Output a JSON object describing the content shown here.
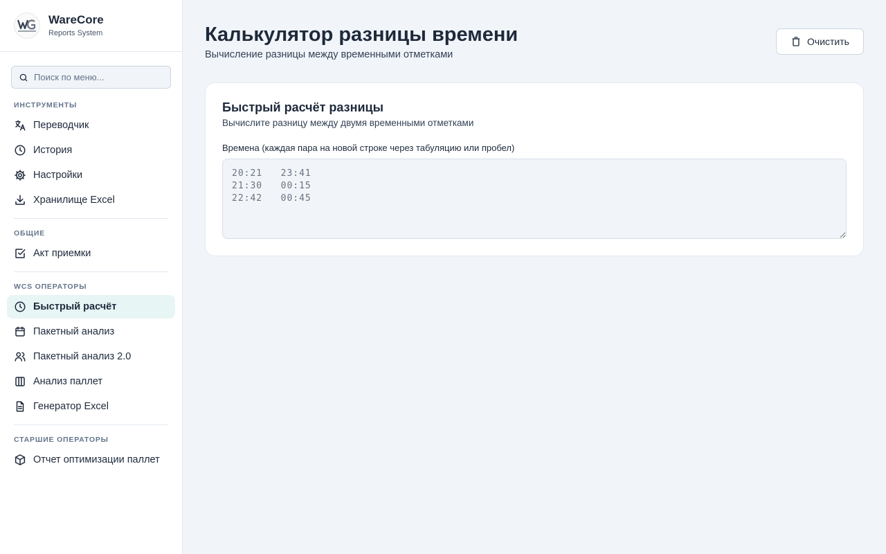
{
  "brand": {
    "name": "WareCore",
    "subtitle": "Reports System"
  },
  "search": {
    "placeholder": "Поиск по меню..."
  },
  "sections": {
    "tools": {
      "title": "ИНСТРУМЕНТЫ",
      "items": [
        "Переводчик",
        "История",
        "Настройки",
        "Хранилище Excel"
      ]
    },
    "general": {
      "title": "ОБЩИЕ",
      "items": [
        "Акт приемки"
      ]
    },
    "wcs": {
      "title": "WCS ОПЕРАТОРЫ",
      "items": [
        "Быстрый расчёт",
        "Пакетный анализ",
        "Пакетный анализ 2.0",
        "Анализ паллет",
        "Генератор Excel"
      ]
    },
    "senior": {
      "title": "СТАРШИЕ ОПЕРАТОРЫ",
      "items": [
        "Отчет оптимизации паллет"
      ]
    }
  },
  "active_item": "Быстрый расчёт",
  "page": {
    "title": "Калькулятор разницы времени",
    "subtitle": "Вычисление разницы между временными отметками",
    "clear_label": "Очистить"
  },
  "card": {
    "title": "Быстрый расчёт разницы",
    "subtitle": "Вычислите разницу между двумя временными отметками",
    "field_label": "Времена (каждая пара на новой строке через табуляцию или пробел)",
    "field_value": "",
    "field_placeholder": "20:21\t23:41\n21:30\t00:15\n22:42\t00:45"
  },
  "colors": {
    "accent_bg": "#e8f5f5",
    "page_bg": "#f1f5f9",
    "text": "#1e293b"
  },
  "icons": {
    "search": "search-icon",
    "translate": "translate-icon",
    "history": "clock-icon",
    "settings": "gear-icon",
    "excel_storage": "download-icon",
    "acceptance": "checkbox-icon",
    "quick_calc": "clock-icon",
    "batch": "calendar-icon",
    "batch2": "users-icon",
    "pallets": "columns-icon",
    "excel_gen": "file-icon",
    "pallet_opt": "box-icon",
    "clear": "trash-icon"
  }
}
